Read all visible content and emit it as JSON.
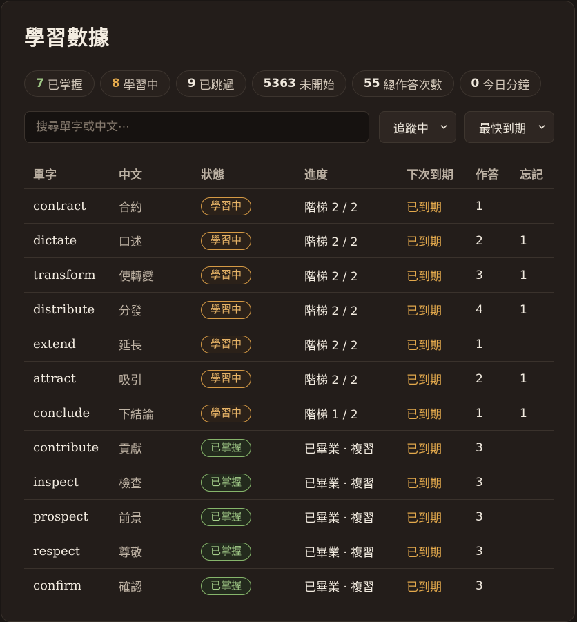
{
  "page": {
    "title": "學習數據"
  },
  "stats": [
    {
      "num": "7",
      "label": "已掌握",
      "tone": "mastered"
    },
    {
      "num": "8",
      "label": "學習中",
      "tone": "learning"
    },
    {
      "num": "9",
      "label": "已跳過",
      "tone": "plain"
    },
    {
      "num": "5363",
      "label": "未開始",
      "tone": "plain"
    },
    {
      "num": "55",
      "label": "總作答次數",
      "tone": "plain"
    },
    {
      "num": "0",
      "label": "今日分鐘",
      "tone": "plain"
    }
  ],
  "filters": {
    "search_placeholder": "搜尋單字或中文⋯",
    "search_value": "",
    "track_value": "追蹤中",
    "sort_value": "最快到期"
  },
  "table": {
    "headers": {
      "word": "單字",
      "zh": "中文",
      "status": "狀態",
      "progress": "進度",
      "due": "下次到期",
      "answers": "作答",
      "forgot": "忘記"
    },
    "rows": [
      {
        "word": "contract",
        "zh": "合約",
        "status": "學習中",
        "status_kind": "learning",
        "progress": "階梯 2 / 2",
        "due": "已到期",
        "answers": "1",
        "forgot": ""
      },
      {
        "word": "dictate",
        "zh": "口述",
        "status": "學習中",
        "status_kind": "learning",
        "progress": "階梯 2 / 2",
        "due": "已到期",
        "answers": "2",
        "forgot": "1"
      },
      {
        "word": "transform",
        "zh": "使轉變",
        "status": "學習中",
        "status_kind": "learning",
        "progress": "階梯 2 / 2",
        "due": "已到期",
        "answers": "3",
        "forgot": "1"
      },
      {
        "word": "distribute",
        "zh": "分發",
        "status": "學習中",
        "status_kind": "learning",
        "progress": "階梯 2 / 2",
        "due": "已到期",
        "answers": "4",
        "forgot": "1"
      },
      {
        "word": "extend",
        "zh": "延長",
        "status": "學習中",
        "status_kind": "learning",
        "progress": "階梯 2 / 2",
        "due": "已到期",
        "answers": "1",
        "forgot": ""
      },
      {
        "word": "attract",
        "zh": "吸引",
        "status": "學習中",
        "status_kind": "learning",
        "progress": "階梯 2 / 2",
        "due": "已到期",
        "answers": "2",
        "forgot": "1"
      },
      {
        "word": "conclude",
        "zh": "下結論",
        "status": "學習中",
        "status_kind": "learning",
        "progress": "階梯 1 / 2",
        "due": "已到期",
        "answers": "1",
        "forgot": "1"
      },
      {
        "word": "contribute",
        "zh": "貢獻",
        "status": "已掌握",
        "status_kind": "mastered",
        "progress": "已畢業 · 複習",
        "due": "已到期",
        "answers": "3",
        "forgot": ""
      },
      {
        "word": "inspect",
        "zh": "檢查",
        "status": "已掌握",
        "status_kind": "mastered",
        "progress": "已畢業 · 複習",
        "due": "已到期",
        "answers": "3",
        "forgot": ""
      },
      {
        "word": "prospect",
        "zh": "前景",
        "status": "已掌握",
        "status_kind": "mastered",
        "progress": "已畢業 · 複習",
        "due": "已到期",
        "answers": "3",
        "forgot": ""
      },
      {
        "word": "respect",
        "zh": "尊敬",
        "status": "已掌握",
        "status_kind": "mastered",
        "progress": "已畢業 · 複習",
        "due": "已到期",
        "answers": "3",
        "forgot": ""
      },
      {
        "word": "confirm",
        "zh": "確認",
        "status": "已掌握",
        "status_kind": "mastered",
        "progress": "已畢業 · 複習",
        "due": "已到期",
        "answers": "3",
        "forgot": ""
      }
    ]
  }
}
